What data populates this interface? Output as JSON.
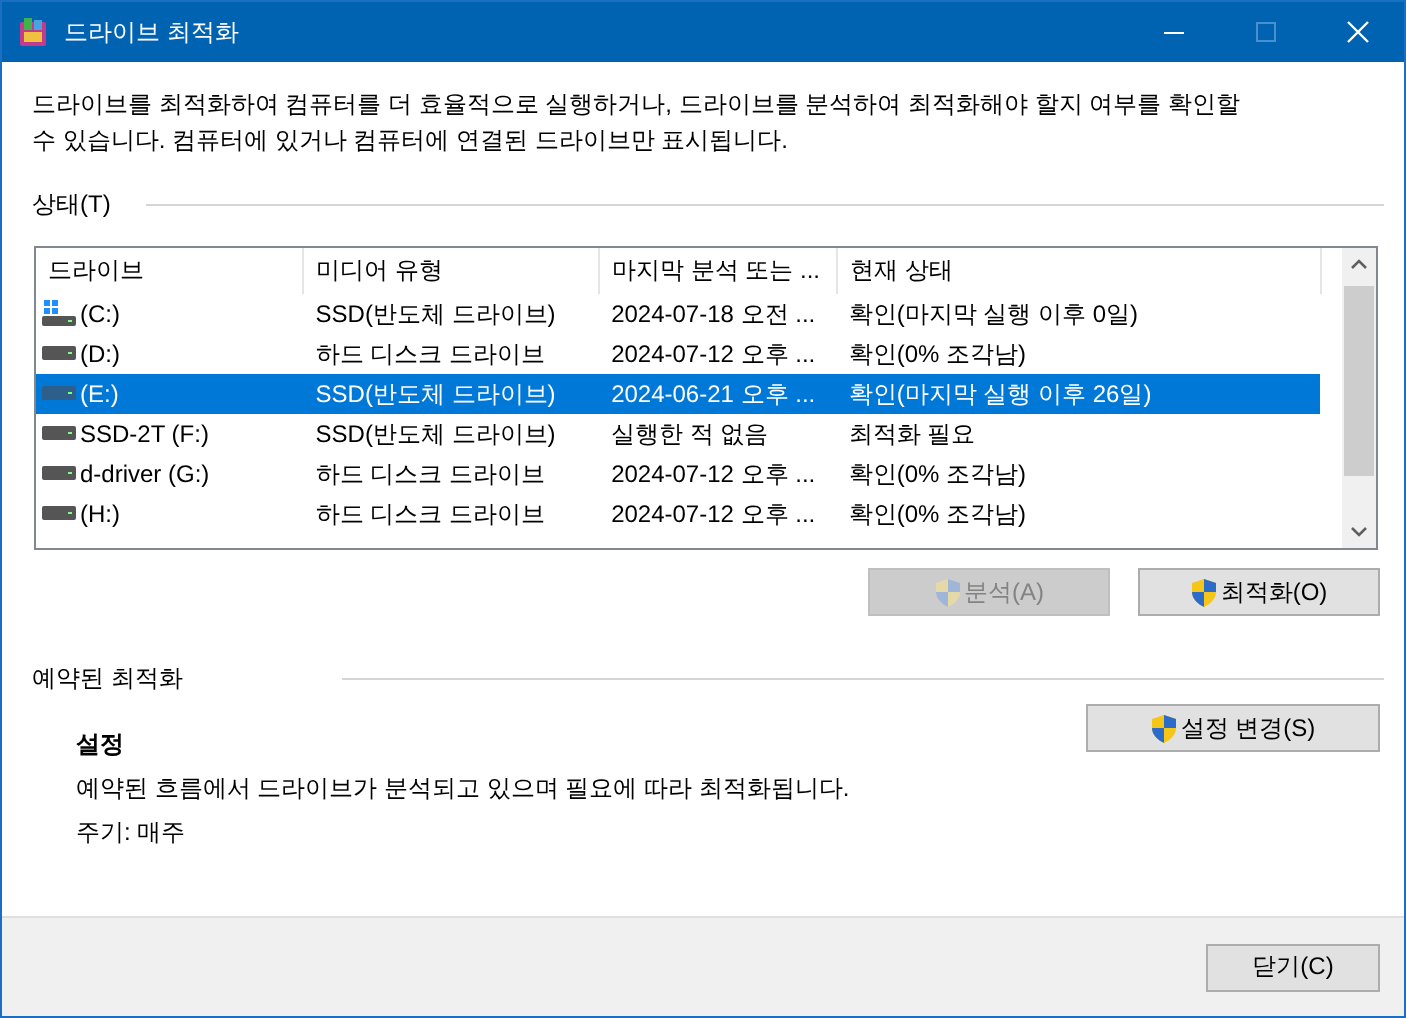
{
  "window": {
    "title": "드라이브 최적화",
    "maximize_disabled": true
  },
  "description": "드라이브를 최적화하여 컴퓨터를 더 효율적으로 실행하거나, 드라이브를 분석하여 최적화해야 할지 여부를 확인할 수 있습니다. 컴퓨터에 있거나 컴퓨터에 연결된 드라이브만 표시됩니다.",
  "status_section": {
    "label": "상태(T)"
  },
  "drives": {
    "columns": [
      "드라이브",
      "미디어 유형",
      "마지막 분석 또는 ...",
      "현재 상태"
    ],
    "rows": [
      {
        "kind": "system",
        "name": "(C:)",
        "media": "SSD(반도체 드라이브)",
        "last_run": "2024-07-18 오전 ...",
        "status": "확인(마지막 실행 이후 0일)",
        "selected": false
      },
      {
        "kind": "drive",
        "name": "(D:)",
        "media": "하드 디스크 드라이브",
        "last_run": "2024-07-12 오후 ...",
        "status": "확인(0% 조각남)",
        "selected": false
      },
      {
        "kind": "drive",
        "name": "(E:)",
        "media": "SSD(반도체 드라이브)",
        "last_run": "2024-06-21 오후 ...",
        "status": "확인(마지막 실행 이후 26일)",
        "selected": true
      },
      {
        "kind": "drive",
        "name": "SSD-2T (F:)",
        "media": "SSD(반도체 드라이브)",
        "last_run": "실행한 적 없음",
        "status": "최적화 필요",
        "selected": false
      },
      {
        "kind": "drive",
        "name": "d-driver (G:)",
        "media": "하드 디스크 드라이브",
        "last_run": "2024-07-12 오후 ...",
        "status": "확인(0% 조각남)",
        "selected": false
      },
      {
        "kind": "drive",
        "name": "(H:)",
        "media": "하드 디스크 드라이브",
        "last_run": "2024-07-12 오후 ...",
        "status": "확인(0% 조각남)",
        "selected": false
      }
    ]
  },
  "actions": [
    {
      "label": "분석(A)",
      "disabled": true
    },
    {
      "label": "최적화(O)",
      "disabled": false
    }
  ],
  "scheduled": {
    "label": "예약된 최적화",
    "heading": "설정",
    "button": "설정 변경(S)",
    "text": "예약된 흐름에서 드라이브가 분석되고 있으며 필요에 따라 최적화됩니다.",
    "frequency": "주기: 매주"
  },
  "close_button": "닫기(C)"
}
